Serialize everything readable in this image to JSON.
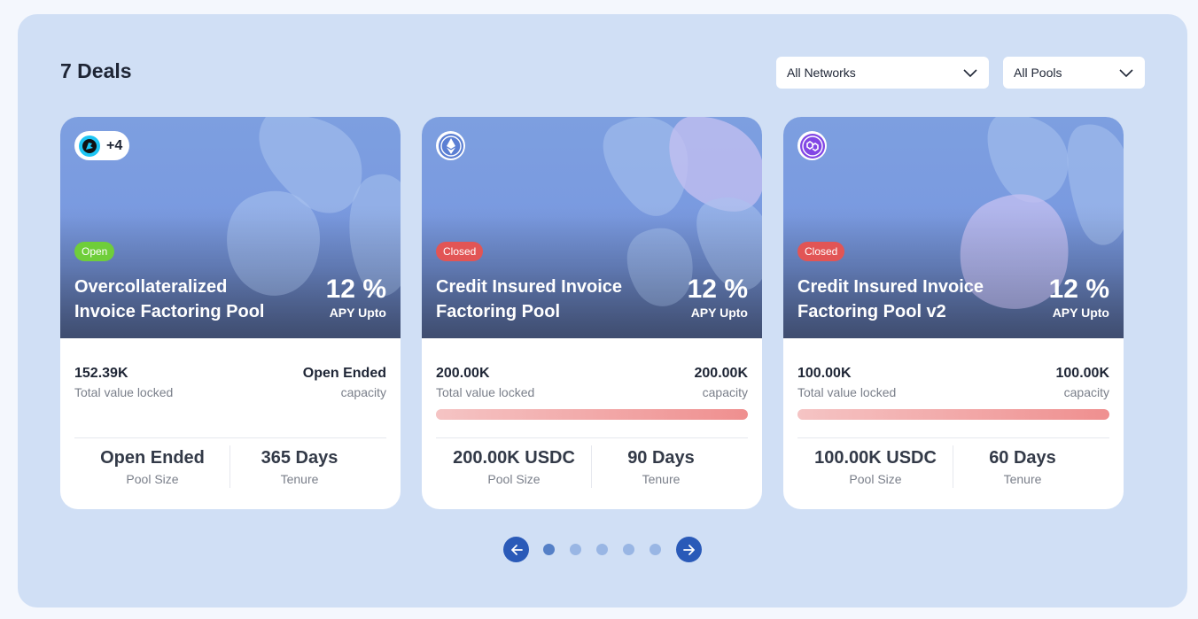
{
  "header": {
    "title": "7 Deals"
  },
  "filters": {
    "network": {
      "selected": "All Networks"
    },
    "pool": {
      "selected": "All Pools"
    }
  },
  "colors": {
    "panel": "#d0dff5",
    "open_badge": "#6fce3a",
    "closed_badge": "#e25555",
    "pager_arrow": "#2a5ab8"
  },
  "cards": [
    {
      "network_icon": "multichain-icon",
      "network_extra": "+4",
      "status": "Open",
      "name": "Overcollateralized Invoice Factoring Pool",
      "apy_value": "12 %",
      "apy_label": "APY Upto",
      "tvl_value": "152.39K",
      "tvl_label": "Total value locked",
      "capacity_value": "Open Ended",
      "capacity_label": "capacity",
      "progress": null,
      "pool_size_value": "Open Ended",
      "pool_size_label": "Pool Size",
      "tenure_value": "365 Days",
      "tenure_label": "Tenure"
    },
    {
      "network_icon": "ethereum-icon",
      "status": "Closed",
      "name": "Credit Insured Invoice Factoring Pool",
      "apy_value": "12 %",
      "apy_label": "APY Upto",
      "tvl_value": "200.00K",
      "tvl_label": "Total value locked",
      "capacity_value": "200.00K",
      "capacity_label": "capacity",
      "progress": 1.0,
      "pool_size_value": "200.00K USDC",
      "pool_size_label": "Pool Size",
      "tenure_value": "90 Days",
      "tenure_label": "Tenure"
    },
    {
      "network_icon": "polygon-icon",
      "status": "Closed",
      "name": "Credit Insured Invoice Factoring Pool v2",
      "apy_value": "12 %",
      "apy_label": "APY Upto",
      "tvl_value": "100.00K",
      "tvl_label": "Total value locked",
      "capacity_value": "100.00K",
      "capacity_label": "capacity",
      "progress": 1.0,
      "pool_size_value": "100.00K USDC",
      "pool_size_label": "Pool Size",
      "tenure_value": "60 Days",
      "tenure_label": "Tenure"
    }
  ],
  "pagination": {
    "pages": 5,
    "current": 1
  }
}
